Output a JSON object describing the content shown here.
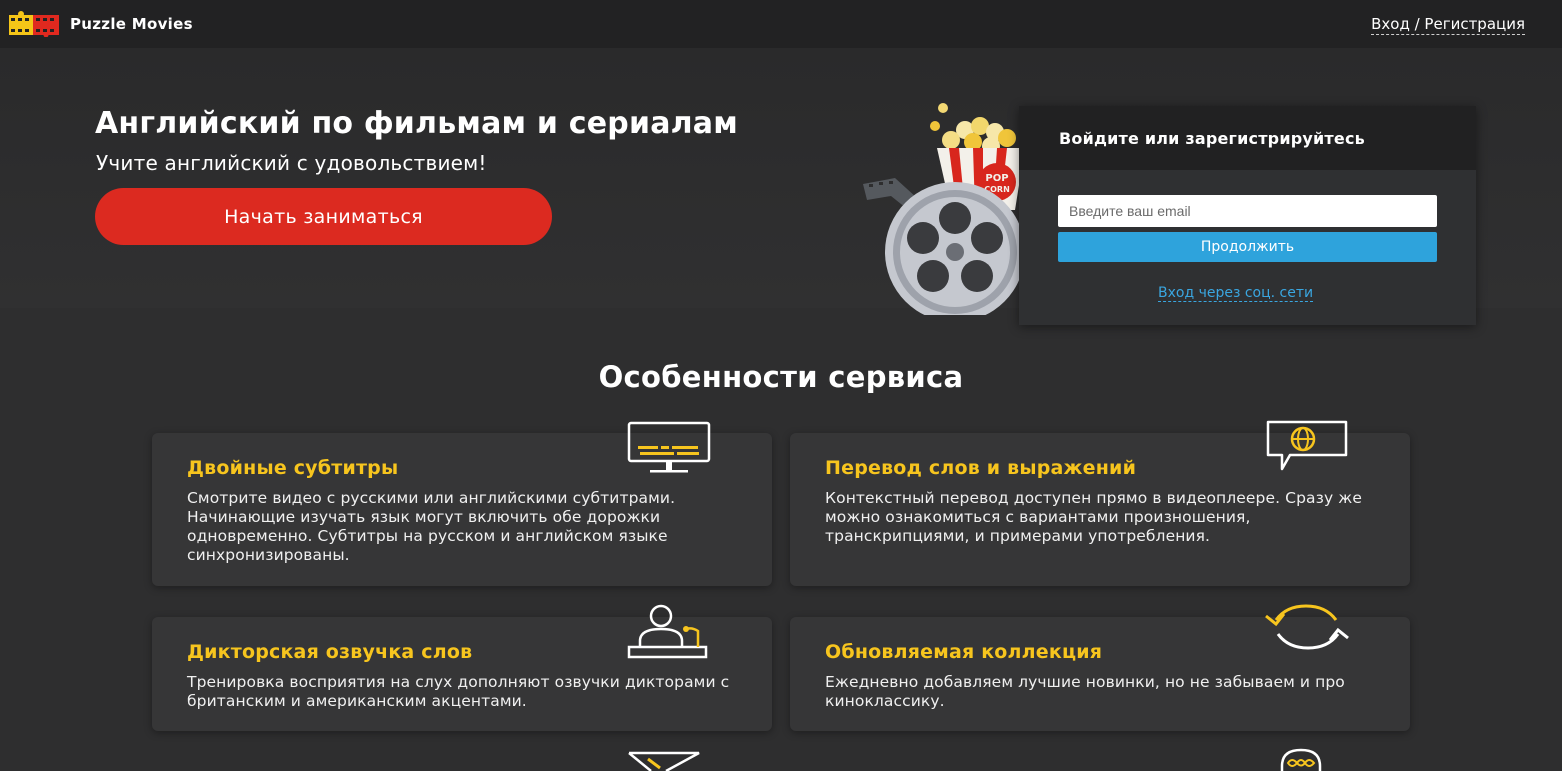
{
  "header": {
    "brand": "Puzzle Movies",
    "login_link": "Вход / Регистрация"
  },
  "hero": {
    "title": "Английский по фильмам и сериалам",
    "subtitle": "Учите английский с удовольствием!",
    "start_button": "Начать заниматься",
    "popcorn_label_1": "POP",
    "popcorn_label_2": "CORN"
  },
  "login_card": {
    "title": "Войдите или зарегистрируйтесь",
    "email_placeholder": "Введите ваш email",
    "continue_button": "Продолжить",
    "social_link": "Вход через соц. сети"
  },
  "features": {
    "title": "Особенности сервиса",
    "items": [
      {
        "title": "Двойные субтитры",
        "text": "Смотрите видео с русскими или английскими субтитрами. Начинающие изучать язык могут включить обе дорожки одновременно. Субтитры на русском и английском языке синхронизированы.",
        "icon": "monitor-subtitles-icon"
      },
      {
        "title": "Перевод слов и выражений",
        "text": "Контекстный перевод доступен прямо в видеоплеере. Сразу же можно ознакомиться с вариантами произношения, транскрипциями, и примерами употребления.",
        "icon": "speech-globe-icon"
      },
      {
        "title": "Дикторская озвучка слов",
        "text": "Тренировка восприятия на слух дополняют озвучки дикторами с британским и американским акцентами.",
        "icon": "speaker-podium-icon"
      },
      {
        "title": "Обновляемая коллекция",
        "text": "Ежедневно добавляем лучшие новинки, но не забываем и про киноклассику.",
        "icon": "refresh-arrows-icon"
      }
    ]
  },
  "colors": {
    "accent_red": "#dc2a20",
    "accent_blue": "#2ea3dc",
    "accent_yellow": "#f7c51e"
  }
}
